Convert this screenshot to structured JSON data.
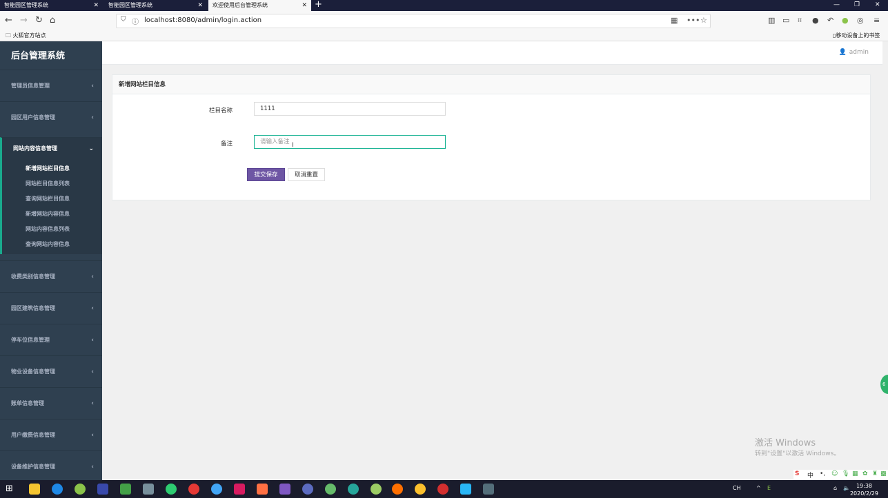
{
  "browser": {
    "tabs": [
      {
        "label": "智能园区管理系统",
        "active": false
      },
      {
        "label": "智能园区管理系统",
        "active": false
      },
      {
        "label": "欢迎使用后台管理系统",
        "active": true
      }
    ],
    "url": "localhost:8080/admin/login.action",
    "bookmarks": {
      "left": "火狐官方站点",
      "right": "移动设备上的书签"
    }
  },
  "sidebar": {
    "brand": "后台管理系统",
    "items": [
      {
        "label": "管理员信息管理"
      },
      {
        "label": "园区用户信息管理"
      },
      {
        "label": "网站内容信息管理",
        "open": true,
        "children": [
          "新增网站栏目信息",
          "网站栏目信息列表",
          "查询网站栏目信息",
          "新增网站内容信息",
          "网站内容信息列表",
          "查询网站内容信息"
        ]
      },
      {
        "label": "收费类别信息管理"
      },
      {
        "label": "园区建筑信息管理"
      },
      {
        "label": "停车位信息管理"
      },
      {
        "label": "物业设备信息管理"
      },
      {
        "label": "账单信息管理"
      },
      {
        "label": "用户缴费信息管理"
      },
      {
        "label": "设备维护信息管理"
      }
    ]
  },
  "topbar": {
    "user": "admin"
  },
  "form": {
    "title": "新增网站栏目信息",
    "name_label": "栏目名称",
    "name_value": "1111",
    "note_label": "备注",
    "note_placeholder": "请输入备注",
    "submit_label": "提交保存",
    "reset_label": "取消重置"
  },
  "watermark": {
    "line1": "激活 Windows",
    "line2": "转到\"设置\"以激活 Windows。"
  },
  "taskbar": {
    "time": "19:38",
    "date": "2020/2/29"
  },
  "colors": {
    "sidebar": "#2f4050",
    "accent": "#19aa8d",
    "primary_button": "#6e56a4"
  }
}
